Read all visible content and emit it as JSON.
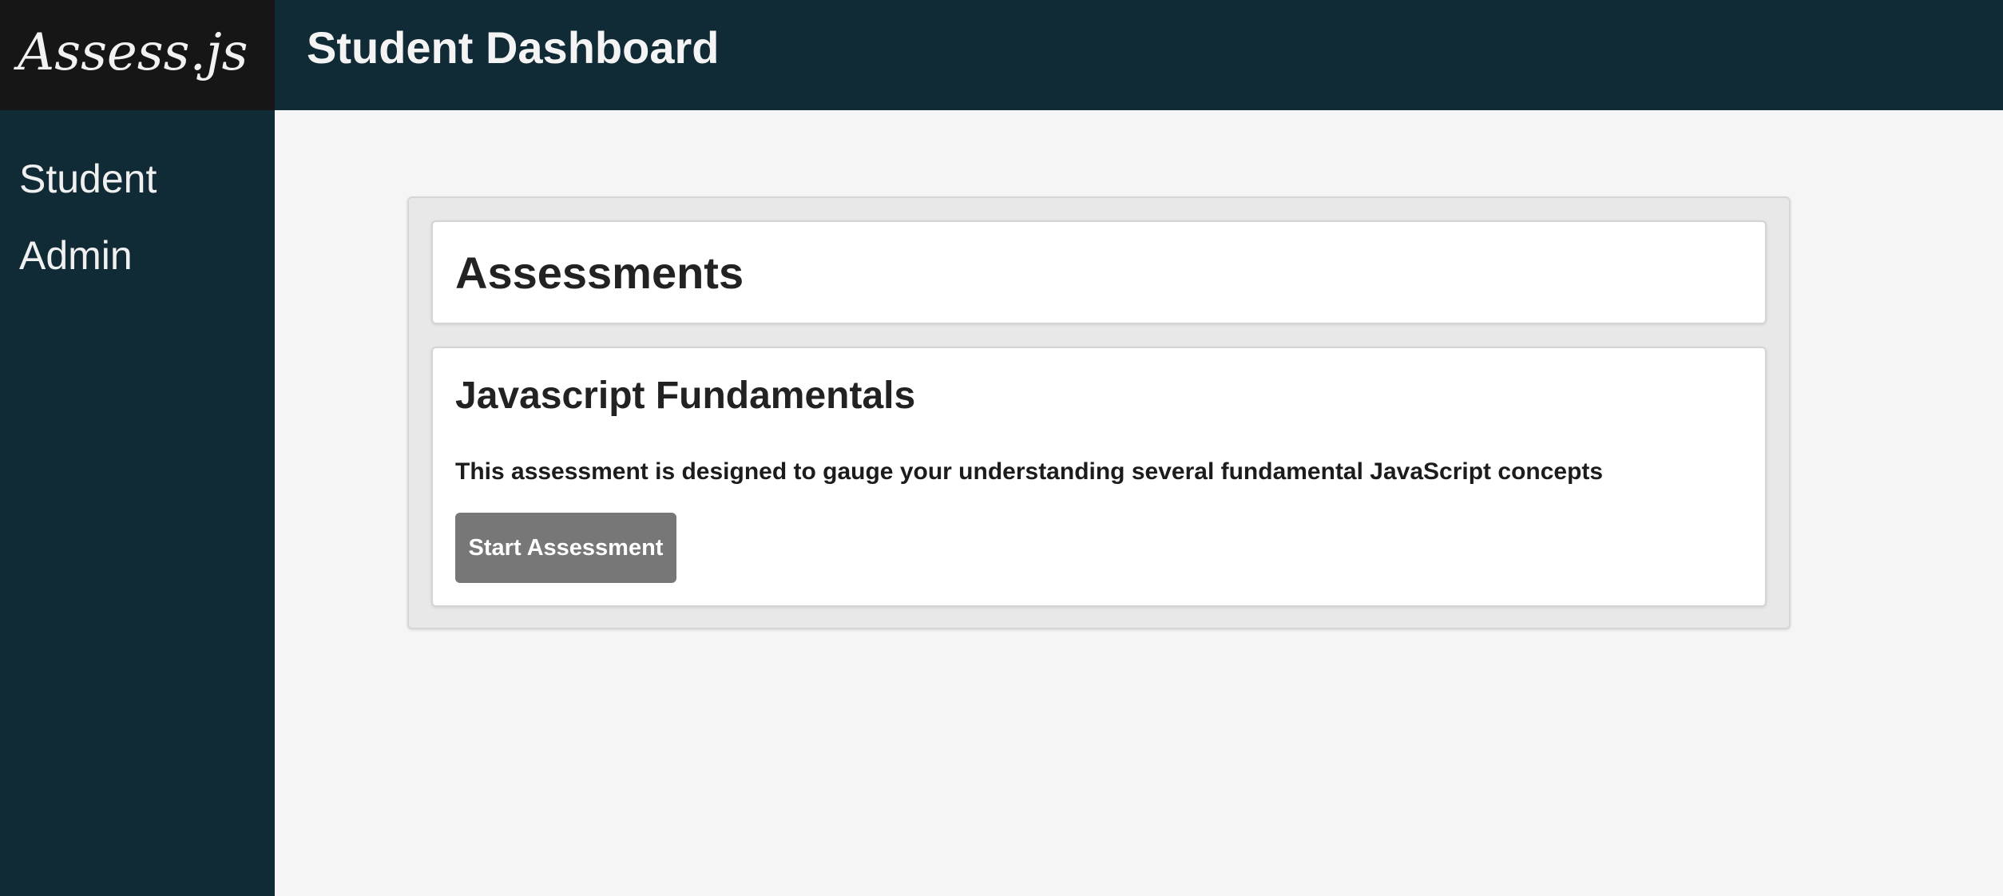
{
  "logo": {
    "text": "Assess.js"
  },
  "header": {
    "title": "Student Dashboard"
  },
  "sidebar": {
    "items": [
      {
        "label": "Student"
      },
      {
        "label": "Admin"
      }
    ]
  },
  "main": {
    "section_title": "Assessments",
    "assessments": [
      {
        "title": "Javascript Fundamentals",
        "description": "This assessment is designed to gauge your understanding several fundamental JavaScript concepts",
        "button_label": "Start Assessment"
      }
    ]
  },
  "colors": {
    "sidebar_bg": "#112b36",
    "logo_bg": "#161616",
    "content_bg": "#f5f5f5",
    "button_bg": "#777777"
  }
}
